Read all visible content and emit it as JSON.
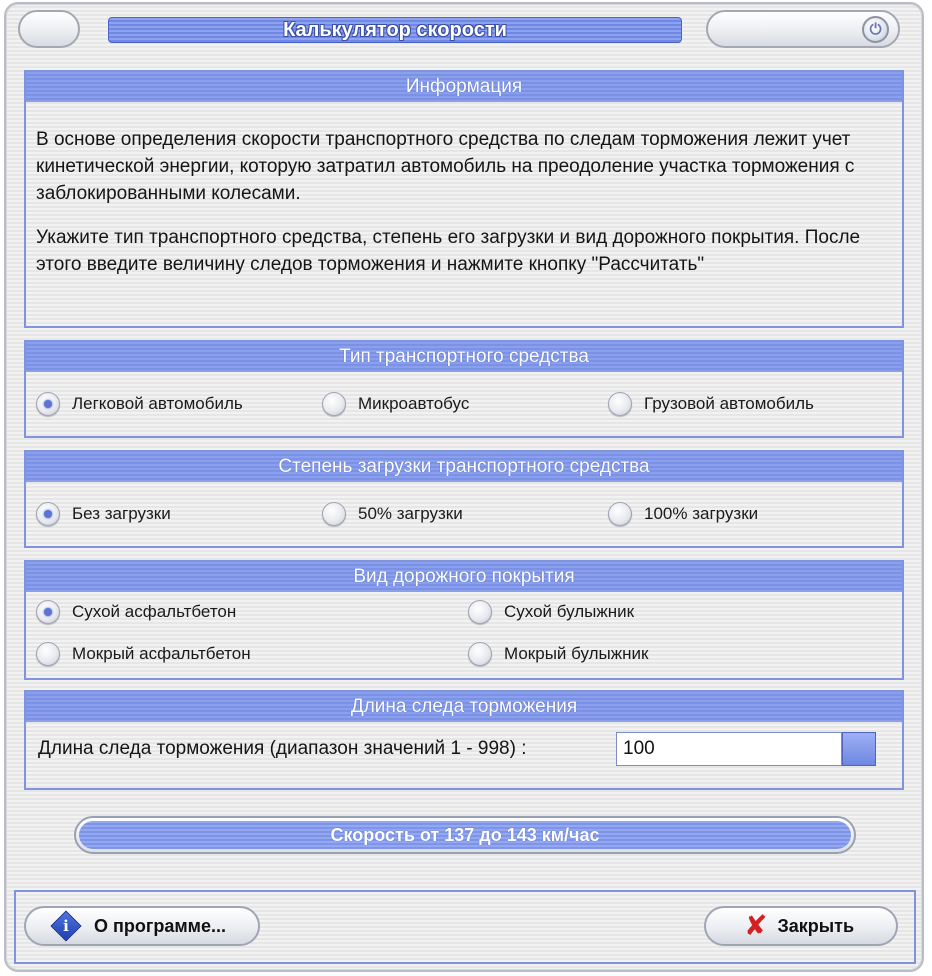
{
  "window": {
    "title": "Калькулятор скорости"
  },
  "info": {
    "header": "Информация",
    "paragraph1": "В основе определения скорости транспортного средства по следам торможения лежит учет кинетической энергии, которую затратил автомобиль на преодоление участка торможения с заблокированными колесами.",
    "paragraph2": "Укажите тип транспортного средства, степень его загрузки и вид дорожного покрытия. После этого введите величину следов торможения и нажмите кнопку \"Рассчитать\""
  },
  "vehicle_type": {
    "header": "Тип транспортного средства",
    "options": [
      {
        "label": "Легковой автомобиль",
        "checked": true
      },
      {
        "label": "Микроавтобус",
        "checked": false
      },
      {
        "label": "Грузовой автомобиль",
        "checked": false
      }
    ]
  },
  "load": {
    "header": "Степень загрузки транспортного средства",
    "options": [
      {
        "label": "Без загрузки",
        "checked": true
      },
      {
        "label": "50% загрузки",
        "checked": false
      },
      {
        "label": "100% загрузки",
        "checked": false
      }
    ]
  },
  "road": {
    "header": "Вид дорожного покрытия",
    "options": [
      {
        "label": "Сухой асфальтбетон",
        "checked": true
      },
      {
        "label": "Сухой булыжник",
        "checked": false
      },
      {
        "label": "Мокрый асфальтбетон",
        "checked": false
      },
      {
        "label": "Мокрый булыжник",
        "checked": false
      }
    ]
  },
  "brake_length": {
    "header": "Длина следа торможения",
    "label": "Длина следа торможения (диапазон значений 1 - 998) :",
    "value": "100"
  },
  "result": {
    "text": "Скорость от 137 до 143 км/час"
  },
  "buttons": {
    "about": "О программе...",
    "close": "Закрыть"
  }
}
